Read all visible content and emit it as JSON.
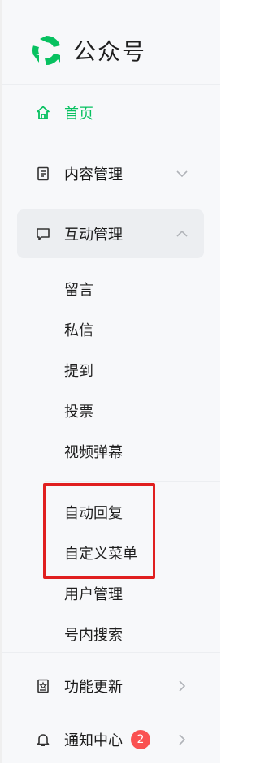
{
  "app": {
    "name": "公众号"
  },
  "colors": {
    "brand_green": "#07c160",
    "highlight_red": "#e01f1f",
    "badge_red": "#fa5151"
  },
  "nav": {
    "home": {
      "label": "首页",
      "icon": "home-icon"
    },
    "content": {
      "label": "内容管理",
      "icon": "document-icon"
    },
    "interaction": {
      "label": "互动管理",
      "icon": "chat-bubble-icon",
      "subitems": [
        "留言",
        "私信",
        "提到",
        "投票",
        "视频弹幕",
        "自动回复",
        "自定义菜单",
        "用户管理",
        "号内搜索"
      ]
    },
    "updates": {
      "label": "功能更新",
      "icon": "book-star-icon"
    },
    "notifications": {
      "label": "通知中心",
      "icon": "bell-icon",
      "badge": "2"
    }
  }
}
